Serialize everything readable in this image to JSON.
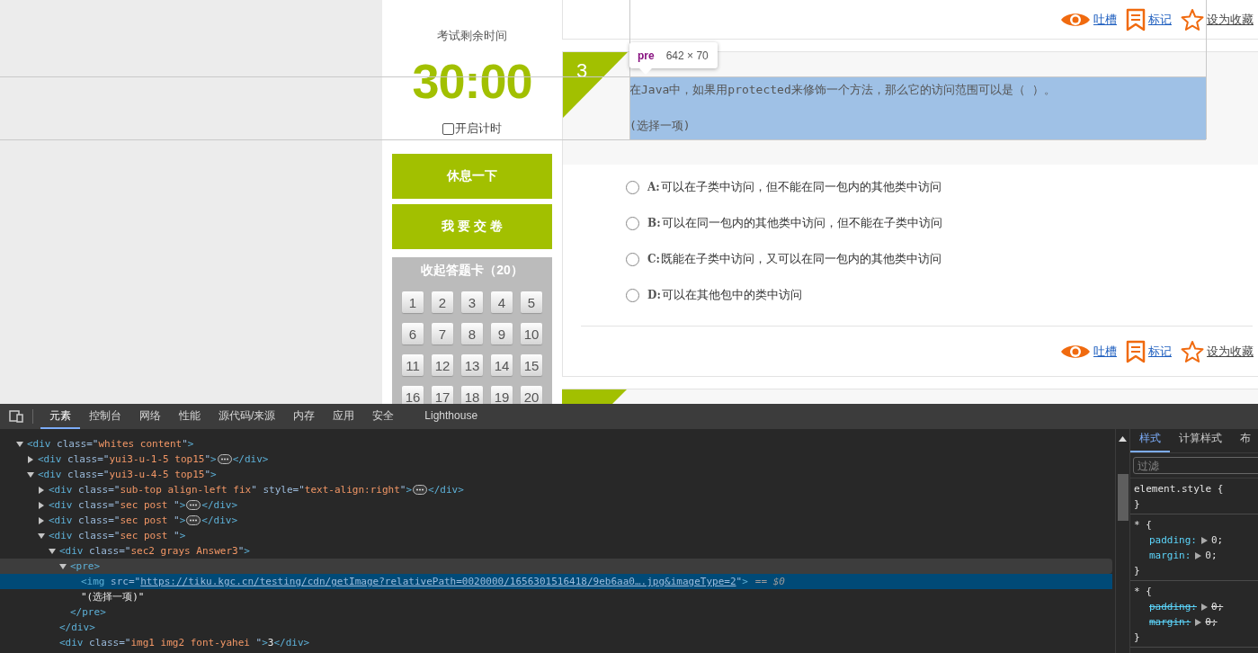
{
  "sidebar": {
    "timer_label": "考试剩余时间",
    "timer": "30:00",
    "timer_toggle": {
      "label": "开启计时",
      "checked": false
    },
    "buttons": [
      "休息一下",
      "我 要 交 卷"
    ],
    "answer_card": {
      "title": "收起答题卡（20）",
      "numbers": [
        "1",
        "2",
        "3",
        "4",
        "5",
        "6",
        "7",
        "8",
        "9",
        "10",
        "11",
        "12",
        "13",
        "14",
        "15",
        "16",
        "17",
        "18",
        "19",
        "20"
      ]
    }
  },
  "top_actions": [
    {
      "kind": "eye",
      "label": "吐槽"
    },
    {
      "kind": "bookmark",
      "label": "标记"
    },
    {
      "kind": "star",
      "label": "设为收藏"
    }
  ],
  "question": {
    "number": "3",
    "text": "在Java中，如果用protected来修饰一个方法，那么它的访问范围可以是（  ）。",
    "hint": "(选择一项)",
    "options": [
      {
        "letter": "A:",
        "text": "可以在子类中访问，但不能在同一包内的其他类中访问",
        "selected": false
      },
      {
        "letter": "B:",
        "text": "可以在同一包内的其他类中访问，但不能在子类中访问",
        "selected": false
      },
      {
        "letter": "C:",
        "text": "既能在子类中访问，又可以在同一包内的其他类中访问",
        "selected": false
      },
      {
        "letter": "D:",
        "text": "可以在其他包中的类中访问",
        "selected": false
      }
    ],
    "actions": [
      {
        "kind": "eye",
        "label": "吐槽"
      },
      {
        "kind": "bookmark",
        "label": "标记"
      },
      {
        "kind": "star",
        "label": "设为收藏"
      }
    ]
  },
  "inspector_tooltip": {
    "tag": "pre",
    "size": "642 × 70"
  },
  "devtools": {
    "tabs": [
      {
        "label": "元素",
        "selected": true
      },
      {
        "label": "控制台",
        "selected": false
      },
      {
        "label": "网络",
        "selected": false
      },
      {
        "label": "性能",
        "selected": false
      },
      {
        "label": "源代码/来源",
        "selected": false
      },
      {
        "label": "内存",
        "selected": false
      },
      {
        "label": "应用",
        "selected": false
      },
      {
        "label": "安全",
        "selected": false
      },
      {
        "label": "Lighthouse",
        "selected": false
      }
    ],
    "dom_tree": [
      {
        "kind": "element",
        "open": "<div class=\"whites content\">",
        "expanded": true,
        "selected": false,
        "hovered": false,
        "children": [
          {
            "kind": "element",
            "open": "<div class=\"yui3-u-1-5 top15\">",
            "close": "</div>",
            "expanded": false,
            "selected": false,
            "hovered": false
          },
          {
            "kind": "element",
            "open": "<div class=\"yui3-u-4-5 top15\">",
            "expanded": true,
            "selected": false,
            "hovered": false,
            "children": [
              {
                "kind": "element",
                "open": "<div class=\"sub-top align-left fix\" style=\"text-align:right\">",
                "close": "</div>",
                "expanded": false,
                "selected": false,
                "hovered": false
              },
              {
                "kind": "element",
                "open": "<div class=\"sec post \">",
                "close": "</div>",
                "expanded": false,
                "selected": false,
                "hovered": false
              },
              {
                "kind": "element",
                "open": "<div class=\"sec post \">",
                "close": "</div>",
                "expanded": false,
                "selected": false,
                "hovered": false
              },
              {
                "kind": "element",
                "open": "<div class=\"sec post \">",
                "expanded": true,
                "selected": false,
                "hovered": false,
                "children": [
                  {
                    "kind": "element",
                    "open": "<div class=\"sec2 grays Answer3\">",
                    "close": "</div>",
                    "expanded": true,
                    "selected": false,
                    "hovered": false,
                    "children": [
                      {
                        "kind": "element",
                        "open": "<pre>",
                        "close": "</pre>",
                        "expanded": true,
                        "selected": false,
                        "hovered": true,
                        "children": [
                          {
                            "kind": "link",
                            "open": "<img src=\"https://tiku.kgc.cn/testing/cdn/getImage?relativePath=0020000/1656301516418/9eb6aa0….jpg&imageType=2\">",
                            "suffix": "== $0",
                            "selected": true,
                            "hovered": false
                          },
                          {
                            "kind": "text",
                            "open": "\"(选择一项)\"",
                            "selected": false,
                            "hovered": false
                          }
                        ]
                      }
                    ]
                  },
                  {
                    "kind": "element",
                    "open": "<div class=\"img1 img2  font-yahei \">3</div>",
                    "selected": false,
                    "hovered": false
                  }
                ]
              }
            ]
          }
        ]
      }
    ],
    "side_tabs": [
      {
        "label": "样式",
        "selected": true
      },
      {
        "label": "计算样式",
        "selected": false
      },
      {
        "label": "布",
        "selected": false
      }
    ],
    "filter": {
      "placeholder": "过滤"
    },
    "rules": [
      {
        "selector": "element.style {",
        "close": "}"
      },
      {
        "selector": "* {",
        "close": "}",
        "props": [
          {
            "name": "padding:",
            "value": "0;",
            "overridden": false
          },
          {
            "name": "margin:",
            "value": "0;",
            "overridden": false
          }
        ]
      },
      {
        "selector": "* {",
        "close": "}",
        "props": [
          {
            "name": "padding:",
            "value": "0;",
            "overridden": true
          },
          {
            "name": "margin:",
            "value": "0;",
            "overridden": true
          }
        ]
      }
    ]
  }
}
